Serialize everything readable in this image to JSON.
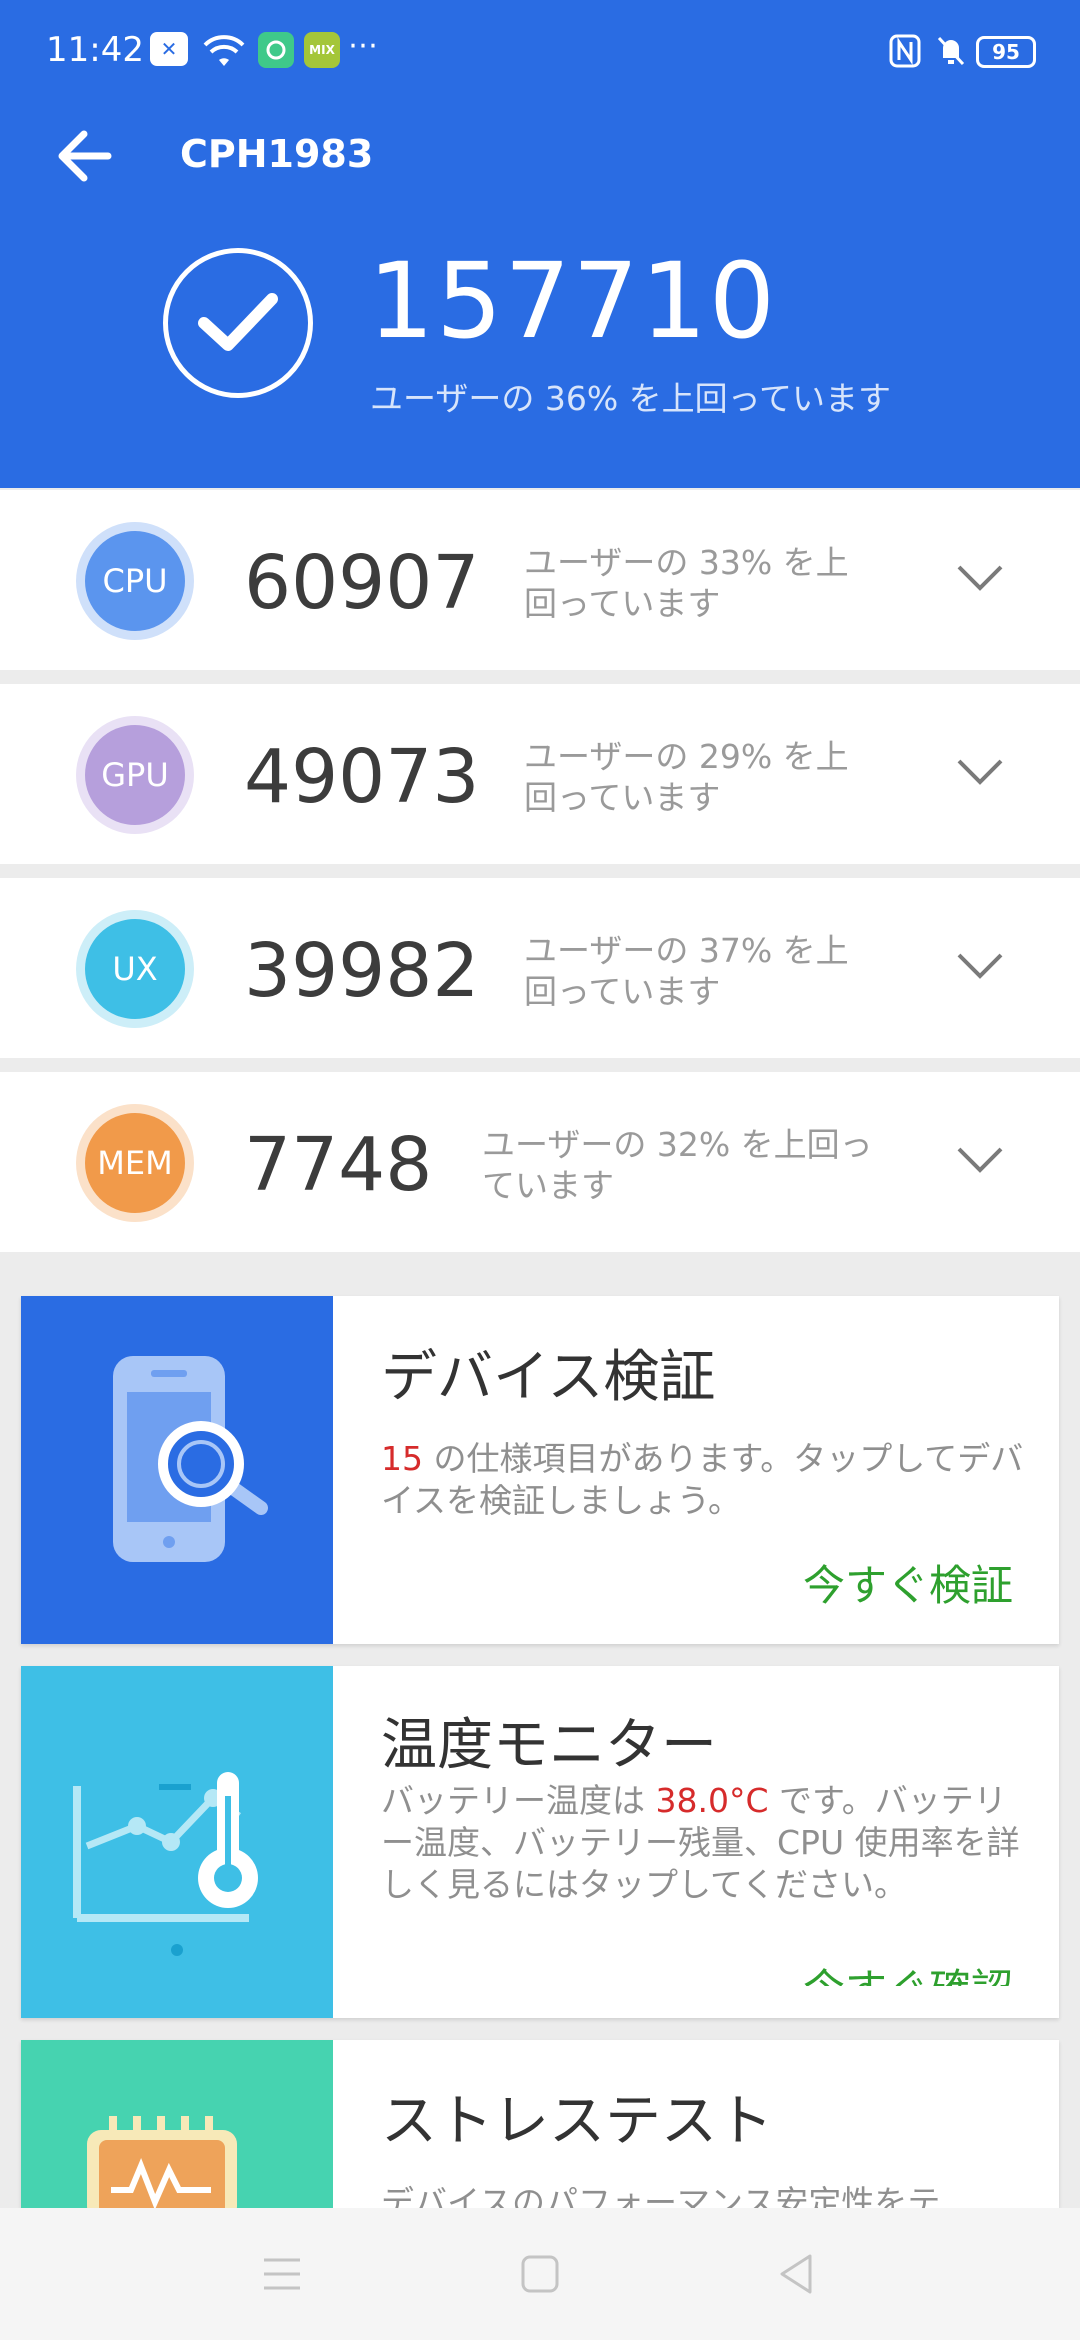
{
  "status_bar": {
    "time": "11:42",
    "battery": "95"
  },
  "header": {
    "title": "CPH1983",
    "total_score": "157710",
    "total_percentile": "ユーザーの 36% を上回っています"
  },
  "rows": [
    {
      "label": "CPU",
      "score": "60907",
      "desc": "ユーザーの 33% を上回っています",
      "color": "#5b95ee",
      "ring": "#cfe0fa"
    },
    {
      "label": "GPU",
      "score": "49073",
      "desc": "ユーザーの 29% を上回っています",
      "color": "#b69fdc",
      "ring": "#e9e1f5"
    },
    {
      "label": "UX",
      "score": "39982",
      "desc": "ユーザーの 37% を上回っています",
      "color": "#3ebfe6",
      "ring": "#cdeef8"
    },
    {
      "label": "MEM",
      "score": "7748",
      "desc": "ユーザーの 32% を上回っています",
      "color": "#f19a4a",
      "ring": "#fbe1c9"
    }
  ],
  "cards": {
    "verify": {
      "title": "デバイス検証",
      "count": "15",
      "text": " の仕様項目があります。タップしてデバイスを検証しましょう。",
      "action": "今すぐ検証",
      "color": "#2a6ce3"
    },
    "temp": {
      "title": "温度モニター",
      "text_before": "バッテリー温度は ",
      "temperature": "38.0°C",
      "text_after": " です。バッテリー温度、バッテリー残量、CPU 使用率を詳しく見るにはタップしてください。",
      "action": "今すぐ確認",
      "color": "#3ebfe6"
    },
    "stress": {
      "title": "ストレステスト",
      "text": "デバイスのパフォーマンス安定性をテ",
      "color": "#46d3b0"
    }
  },
  "icons": [
    "back-arrow-icon",
    "check-icon",
    "chevron-down-icon",
    "phone-search-icon",
    "thermometer-chart-icon",
    "chip-icon",
    "menu-icon",
    "home-icon",
    "back-triangle-icon"
  ]
}
